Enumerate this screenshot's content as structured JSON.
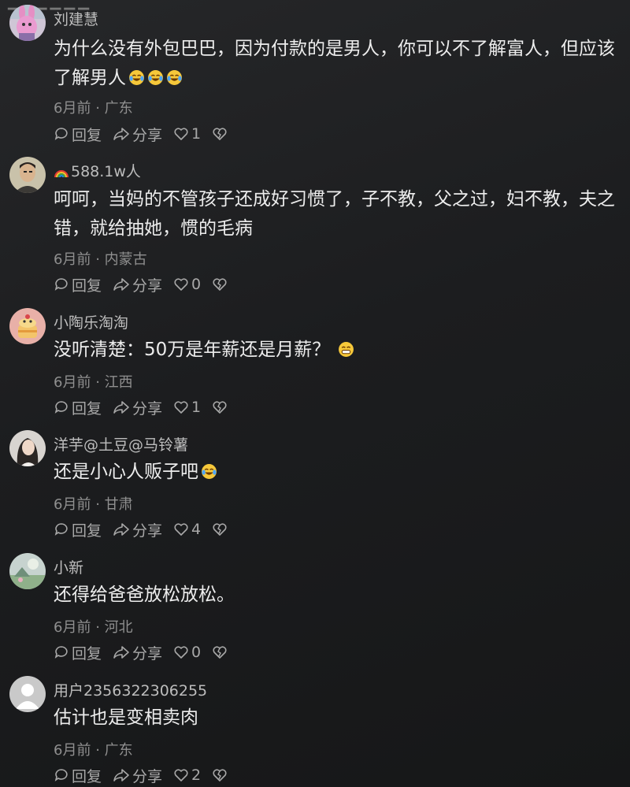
{
  "comments": [
    {
      "avatar_icon": "pink-rabbit-avatar-icon",
      "username": "刘建慧",
      "text": "为什么没有外包巴巴，因为付款的是男人，你可以不了解富人，但应该了解男人",
      "emoji": [
        "laugh-cry-emoji",
        "laugh-cry-emoji",
        "laugh-cry-emoji"
      ],
      "time": "6月前",
      "location": "广东",
      "reply_label": "回复",
      "share_label": "分享",
      "likes": "1"
    },
    {
      "avatar_icon": "man-portrait-avatar-icon",
      "username_prefix_icon": "rainbow-emoji",
      "username": "588.1w人",
      "text": "呵呵，当妈的不管孩子还成好习惯了，子不教，父之过，妇不教，夫之错，就给抽她，惯的毛病",
      "emoji": [],
      "time": "6月前",
      "location": "内蒙古",
      "reply_label": "回复",
      "share_label": "分享",
      "likes": "0"
    },
    {
      "avatar_icon": "cartoon-cake-avatar-icon",
      "username": "小陶乐淘淘",
      "text": "没听清楚：50万是年薪还是月薪？",
      "emoji": [
        "grin-emoji"
      ],
      "time": "6月前",
      "location": "江西",
      "reply_label": "回复",
      "share_label": "分享",
      "likes": "1"
    },
    {
      "avatar_icon": "woman-portrait-avatar-icon",
      "username": "洋芋@土豆@马铃薯",
      "text": "还是小心人贩子吧",
      "emoji": [
        "laugh-cry-emoji"
      ],
      "time": "6月前",
      "location": "甘肃",
      "reply_label": "回复",
      "share_label": "分享",
      "likes": "4"
    },
    {
      "avatar_icon": "landscape-avatar-icon",
      "username": "小新",
      "text": "还得给爸爸放松放松。",
      "emoji": [],
      "time": "6月前",
      "location": "河北",
      "reply_label": "回复",
      "share_label": "分享",
      "likes": "0"
    },
    {
      "avatar_icon": "default-user-avatar-icon",
      "username": "用户2356322306255",
      "text": "估计也是变相卖肉",
      "emoji": [],
      "time": "6月前",
      "location": "广东",
      "reply_label": "回复",
      "share_label": "分享",
      "likes": "2"
    }
  ],
  "meta_separator": "·",
  "colors": {
    "background": "#1c1d1f",
    "text": "#ececec",
    "username": "#bdbdbd",
    "meta": "#8f8f8f",
    "action": "#a8a8a8"
  }
}
